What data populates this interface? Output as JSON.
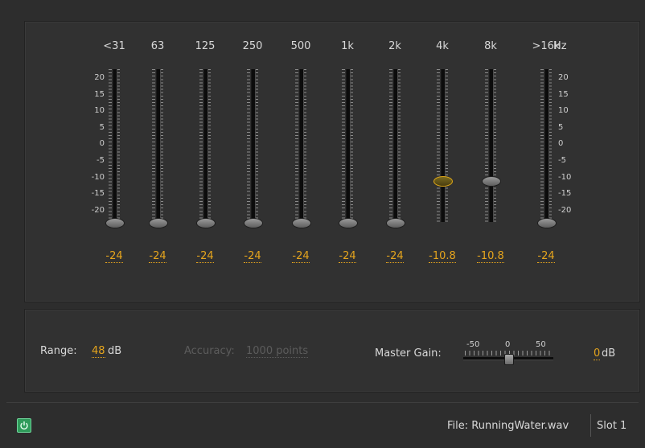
{
  "equalizer": {
    "bands": [
      {
        "freq": "<31",
        "value": "-24",
        "gain_db": -24,
        "selected": false
      },
      {
        "freq": "63",
        "value": "-24",
        "gain_db": -24,
        "selected": false
      },
      {
        "freq": "125",
        "value": "-24",
        "gain_db": -24,
        "selected": false
      },
      {
        "freq": "250",
        "value": "-24",
        "gain_db": -24,
        "selected": false
      },
      {
        "freq": "500",
        "value": "-24",
        "gain_db": -24,
        "selected": false
      },
      {
        "freq": "1k",
        "value": "-24",
        "gain_db": -24,
        "selected": false
      },
      {
        "freq": "2k",
        "value": "-24",
        "gain_db": -24,
        "selected": false
      },
      {
        "freq": "4k",
        "value": "-10.8",
        "gain_db": -10.8,
        "selected": true
      },
      {
        "freq": "8k",
        "value": "-10.8",
        "gain_db": -10.8,
        "selected": false
      },
      {
        "freq": ">16k",
        "value": "-24",
        "gain_db": -24,
        "selected": false
      }
    ],
    "unit_label": "Hz",
    "scale": [
      "20",
      "15",
      "10",
      "5",
      "0",
      "-5",
      "-10",
      "-15",
      "-20"
    ]
  },
  "settings": {
    "range_label": "Range:",
    "range_value": "48",
    "range_unit": "dB",
    "accuracy_label": "Accuracy:",
    "accuracy_value": "1000 points",
    "master_gain_label": "Master Gain:",
    "master_gain_scale": [
      "-50",
      "0",
      "50"
    ],
    "master_gain_value": "0",
    "master_gain_db": 0,
    "master_gain_unit": "dB"
  },
  "footer": {
    "file_label": "File: RunningWater.wav",
    "slot_label": "Slot 1"
  },
  "colors": {
    "accent": "#e6a51d",
    "power": "#2f9b5a"
  }
}
